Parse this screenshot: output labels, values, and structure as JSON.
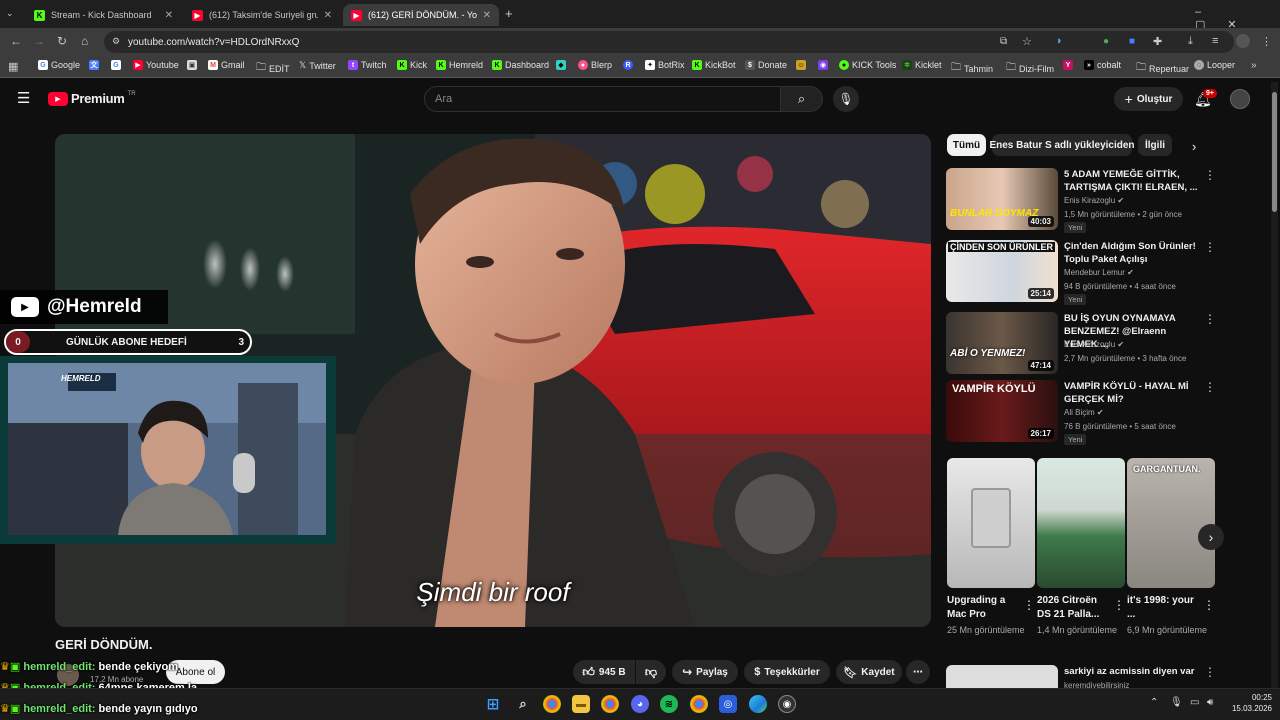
{
  "browser": {
    "tabs": [
      {
        "label": "Stream - Kick Dashboard",
        "icon": "kick-icon",
        "active": false
      },
      {
        "label": "(612) Taksim'de Suriyeli grubun...",
        "icon": "youtube-icon",
        "active": false
      },
      {
        "label": "(612) GERİ DÖNDÜM. - YouTube",
        "icon": "youtube-icon",
        "active": true
      }
    ],
    "url": "youtube.com/watch?v=HDLOrdNRxxQ",
    "bookmarks": [
      "Google",
      "Youtube",
      "Gmail",
      "EDİT",
      "Twitter",
      "Twitch",
      "Kick",
      "Hemreld",
      "Dashboard",
      "Blerp",
      "BotRix",
      "KickBot",
      "Donate",
      "KICK Tools",
      "Kicklet",
      "Tahmin",
      "Dizi-Film",
      "cobalt",
      "Repertuar",
      "Looper"
    ]
  },
  "youtube": {
    "logo_text": "Premium",
    "logo_badge": "TR",
    "search_placeholder": "Ara",
    "create_label": "Oluştur",
    "notif_count": "9+"
  },
  "video": {
    "subtitle": "Şimdi bir roof",
    "title": "GERİ DÖNDÜM.",
    "channel_handle": "@Hemreld",
    "goal_label": "GÜNLÜK ABONE HEDEFİ",
    "goal_current": "0",
    "goal_target": "3",
    "webcam_logo": "HEMRELD",
    "channel_subs": "17,2 Mn abone",
    "subscribe_label": "Abone ol",
    "like_count": "945 B",
    "share_label": "Paylaş",
    "thanks_label": "Teşekkürler",
    "save_label": "Kaydet"
  },
  "chips": [
    "Tümü",
    "Enes Batur S adlı yükleyiciden",
    "İlgili"
  ],
  "recommendations": [
    {
      "title": "5 ADAM YEMEĞE GİTTİK, TARTIŞMA ÇIKTI! ELRAEN, ...",
      "channel": "Enis Kirazoglu",
      "meta": "1,5 Mn görüntüleme • 2 gün önce",
      "new": "Yeni",
      "duration": "40:03",
      "thumb_text": "BUNLAR DOYMAZ"
    },
    {
      "title": "Çin'den Aldığım Son Ürünler! Toplu Paket Açılışı",
      "channel": "Mendebur Lemur",
      "meta": "94 B görüntüleme • 4 saat önce",
      "new": "Yeni",
      "duration": "25:14",
      "thumb_text": "ÇİNDEN SON ÜRÜNLER"
    },
    {
      "title": "BU İŞ OYUN OYNAMAYA BENZEMEZ! @Elraenn YEMEK ...",
      "channel": "Enis Kirazoglu",
      "meta": "2,7 Mn görüntüleme • 3 hafta önce",
      "new": "",
      "duration": "47:14",
      "thumb_text": "ABİ O YENMEZ!"
    },
    {
      "title": "VAMPİR KÖYLÜ - HAYAL Mİ GERÇEK Mİ?",
      "channel": "Ali Biçim",
      "meta": "76 B görüntüleme • 5 saat önce",
      "new": "Yeni",
      "duration": "26:17",
      "thumb_text": "VAMPİR KÖYLÜ"
    }
  ],
  "shorts": [
    {
      "title": "Upgrading a Mac Pro",
      "views": "25 Mn görüntüleme"
    },
    {
      "title": "2026 Citroën DS 21 Palla...",
      "views": "1,4 Mn görüntüleme"
    },
    {
      "title": "it's 1998: your ...",
      "views": "6,9 Mn görüntüleme",
      "thumb_text": "GARGANTUAN."
    }
  ],
  "next_rec": {
    "title": "sarkiyi az acmissin diyen var",
    "channel": "keremdiyebilirsiniz"
  },
  "chat": [
    {
      "user": "hemreld_edit:",
      "msg": "bende çekiyom"
    },
    {
      "user": "hemreld_edit:",
      "msg": "64mps kamerem la"
    },
    {
      "user": "hemreld_edit:",
      "msg": "bende yayın gıdıyo"
    }
  ],
  "clock": {
    "time": "00:25",
    "date": "15.03.2026"
  },
  "colors": {
    "youtube_red": "#ff0033",
    "kick_green": "#53fc18",
    "bg": "#0f0f0f"
  }
}
